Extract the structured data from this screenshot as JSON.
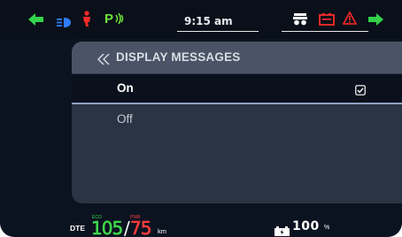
{
  "status_bar": {
    "time": "9:15 am",
    "indicators": [
      "left-turn-arrow-icon",
      "headlight-beam-icon",
      "seatbelt-warning-icon",
      "park-assist-icon",
      "cruise-control-icon",
      "battery-warning-icon",
      "hazard-triangle-icon",
      "right-turn-arrow-icon"
    ],
    "colors": {
      "turn": "#33d24a",
      "headlight": "#2f7dff",
      "warning_red": "#ff2a2a",
      "park": "#6ee33c"
    }
  },
  "menu": {
    "title": "DISPLAY MESSAGES",
    "back_icon": "double-chevron-left-icon",
    "options": [
      {
        "label": "On",
        "selected": true,
        "checked": true
      },
      {
        "label": "Off",
        "selected": false,
        "checked": false
      }
    ]
  },
  "bottom_bar": {
    "dte_label": "DTE",
    "eco_tag": "ECO",
    "eco_value": "105",
    "separator": "/",
    "pwr_tag": "PWR",
    "pwr_value": "75",
    "unit": "km",
    "battery_value": "100",
    "battery_unit": "%",
    "colors": {
      "eco": "#3fd84a",
      "pwr": "#ff3b3b"
    }
  }
}
